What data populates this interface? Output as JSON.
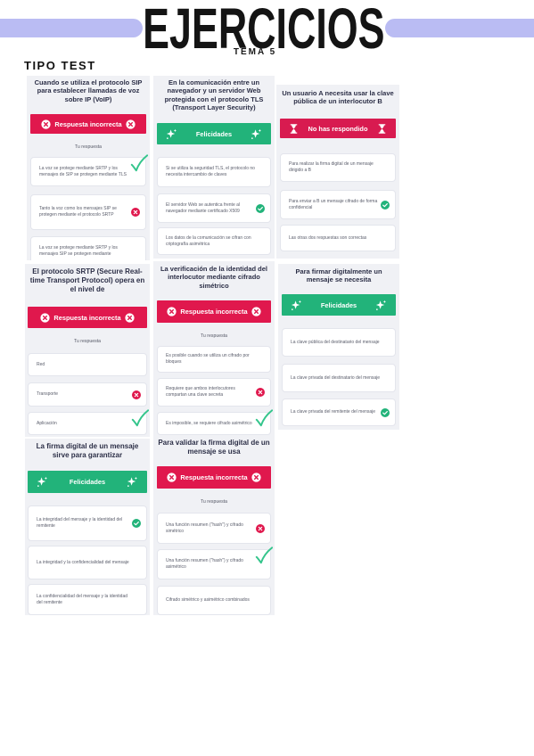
{
  "header": {
    "title": "EJERCICIOS",
    "subtitle": "TEMA 5"
  },
  "section_title": "TIPO TEST",
  "colors": {
    "accent_bar": "#babcf3",
    "card_background": "#f0f1f5",
    "correct": "#22b37a",
    "incorrect": "#e0184d",
    "unanswered": "#d81b50",
    "handwritten_check": "#35c58c"
  },
  "cards": [
    {
      "question": "Cuando se utiliza el protocolo SIP para establecer llamadas de voz sobre IP (VoIP)",
      "result": {
        "label": "Respuesta incorrecta",
        "icon": "circle-x-icon",
        "color": "#e0184d"
      },
      "your_answer_label": "Tu respuesta",
      "options": [
        {
          "text": "La voz se protege mediante SRTP y los mensajes de SIP se protegen mediante TLS",
          "annotation": "handwritten-check-icon"
        },
        {
          "text": "Tanto la voz como los mensajes SIP se protegen mediante el protocolo SRTP",
          "mark": "x-circle-icon"
        },
        {
          "text": "La voz se protege mediante SRTP y los mensajes SIP se protegen mediante"
        }
      ]
    },
    {
      "question": "En la comunicación entre un navegador y un servidor Web protegida con el protocolo TLS (Transport Layer Security)",
      "result": {
        "label": "Felicidades",
        "icon": "sparkle-icon",
        "color": "#22b37a"
      },
      "options": [
        {
          "text": "Si se utiliza la seguridad TLS, el protocolo no necesita intercambio de claves"
        },
        {
          "text": "El servidor Web se autentica frente al navegador mediante certificado X509",
          "mark": "check-circle-icon"
        },
        {
          "text": "Los datos de la comunicación se cifran con criptografía asimétrica"
        }
      ]
    },
    {
      "question": "Un usuario A necesita usar la clave pública de un interlocutor B",
      "result": {
        "label": "No has respondido",
        "icon": "hourglass-icon",
        "color": "#d81b50"
      },
      "options": [
        {
          "text": "Para realizar la firma digital de un mensaje dirigido a B"
        },
        {
          "text": "Para enviar a B un mensaje cifrado de forma confidencial",
          "mark": "check-circle-icon"
        },
        {
          "text": "Las otras dos respuestas son correctas"
        }
      ]
    },
    {
      "question": "El protocolo SRTP (Secure Real-time Transport Protocol) opera en el nivel de",
      "result": {
        "label": "Respuesta incorrecta",
        "icon": "circle-x-icon",
        "color": "#e0184d"
      },
      "your_answer_label": "Tu respuesta",
      "options": [
        {
          "text": "Red"
        },
        {
          "text": "Transporte",
          "mark": "x-circle-icon"
        },
        {
          "text": "Aplicación",
          "annotation": "handwritten-check-icon"
        }
      ]
    },
    {
      "question": "La verificación de la identidad del interlocutor mediante cifrado simétrico",
      "result": {
        "label": "Respuesta incorrecta",
        "icon": "circle-x-icon",
        "color": "#e0184d"
      },
      "your_answer_label": "Tu respuesta",
      "options": [
        {
          "text": "Es posible cuando se utiliza un cifrado por bloques"
        },
        {
          "text": "Requiere que ambos interlocutores compartan una clave secreta",
          "mark": "x-circle-icon"
        },
        {
          "text": "Es imposible, se requiere cifrado asimétrico",
          "annotation": "handwritten-check-icon"
        }
      ]
    },
    {
      "question": "Para firmar digitalmente un mensaje se necesita",
      "result": {
        "label": "Felicidades",
        "icon": "sparkle-icon",
        "color": "#22b37a"
      },
      "options": [
        {
          "text": "La clave pública del destinatario del mensaje"
        },
        {
          "text": "La clave privada del destinatario del mensaje"
        },
        {
          "text": "La clave privada del remitente del mensaje",
          "mark": "check-circle-icon"
        }
      ]
    },
    {
      "question": "La firma digital de un mensaje sirve para garantizar",
      "result": {
        "label": "Felicidades",
        "icon": "sparkle-icon",
        "color": "#22b37a"
      },
      "options": [
        {
          "text": "La integridad del mensaje y la identidad del remitente",
          "mark": "check-circle-icon"
        },
        {
          "text": "La integridad y la confidencialidad del mensaje"
        },
        {
          "text": "La confidencialidad del mensaje y la identidad del remitente"
        }
      ]
    },
    {
      "question": "Para validar la firma digital de un mensaje se usa",
      "result": {
        "label": "Respuesta incorrecta",
        "icon": "circle-x-icon",
        "color": "#e0184d"
      },
      "your_answer_label": "Tu respuesta",
      "options": [
        {
          "text": "Una función resumen (\"hash\") y cifrado simétrico",
          "mark": "x-circle-icon"
        },
        {
          "text": "Una función resumen (\"hash\") y cifrado asimétrico",
          "annotation": "handwritten-check-icon"
        },
        {
          "text": "Cifrado simétrico y asimétrico combinados"
        }
      ]
    }
  ]
}
